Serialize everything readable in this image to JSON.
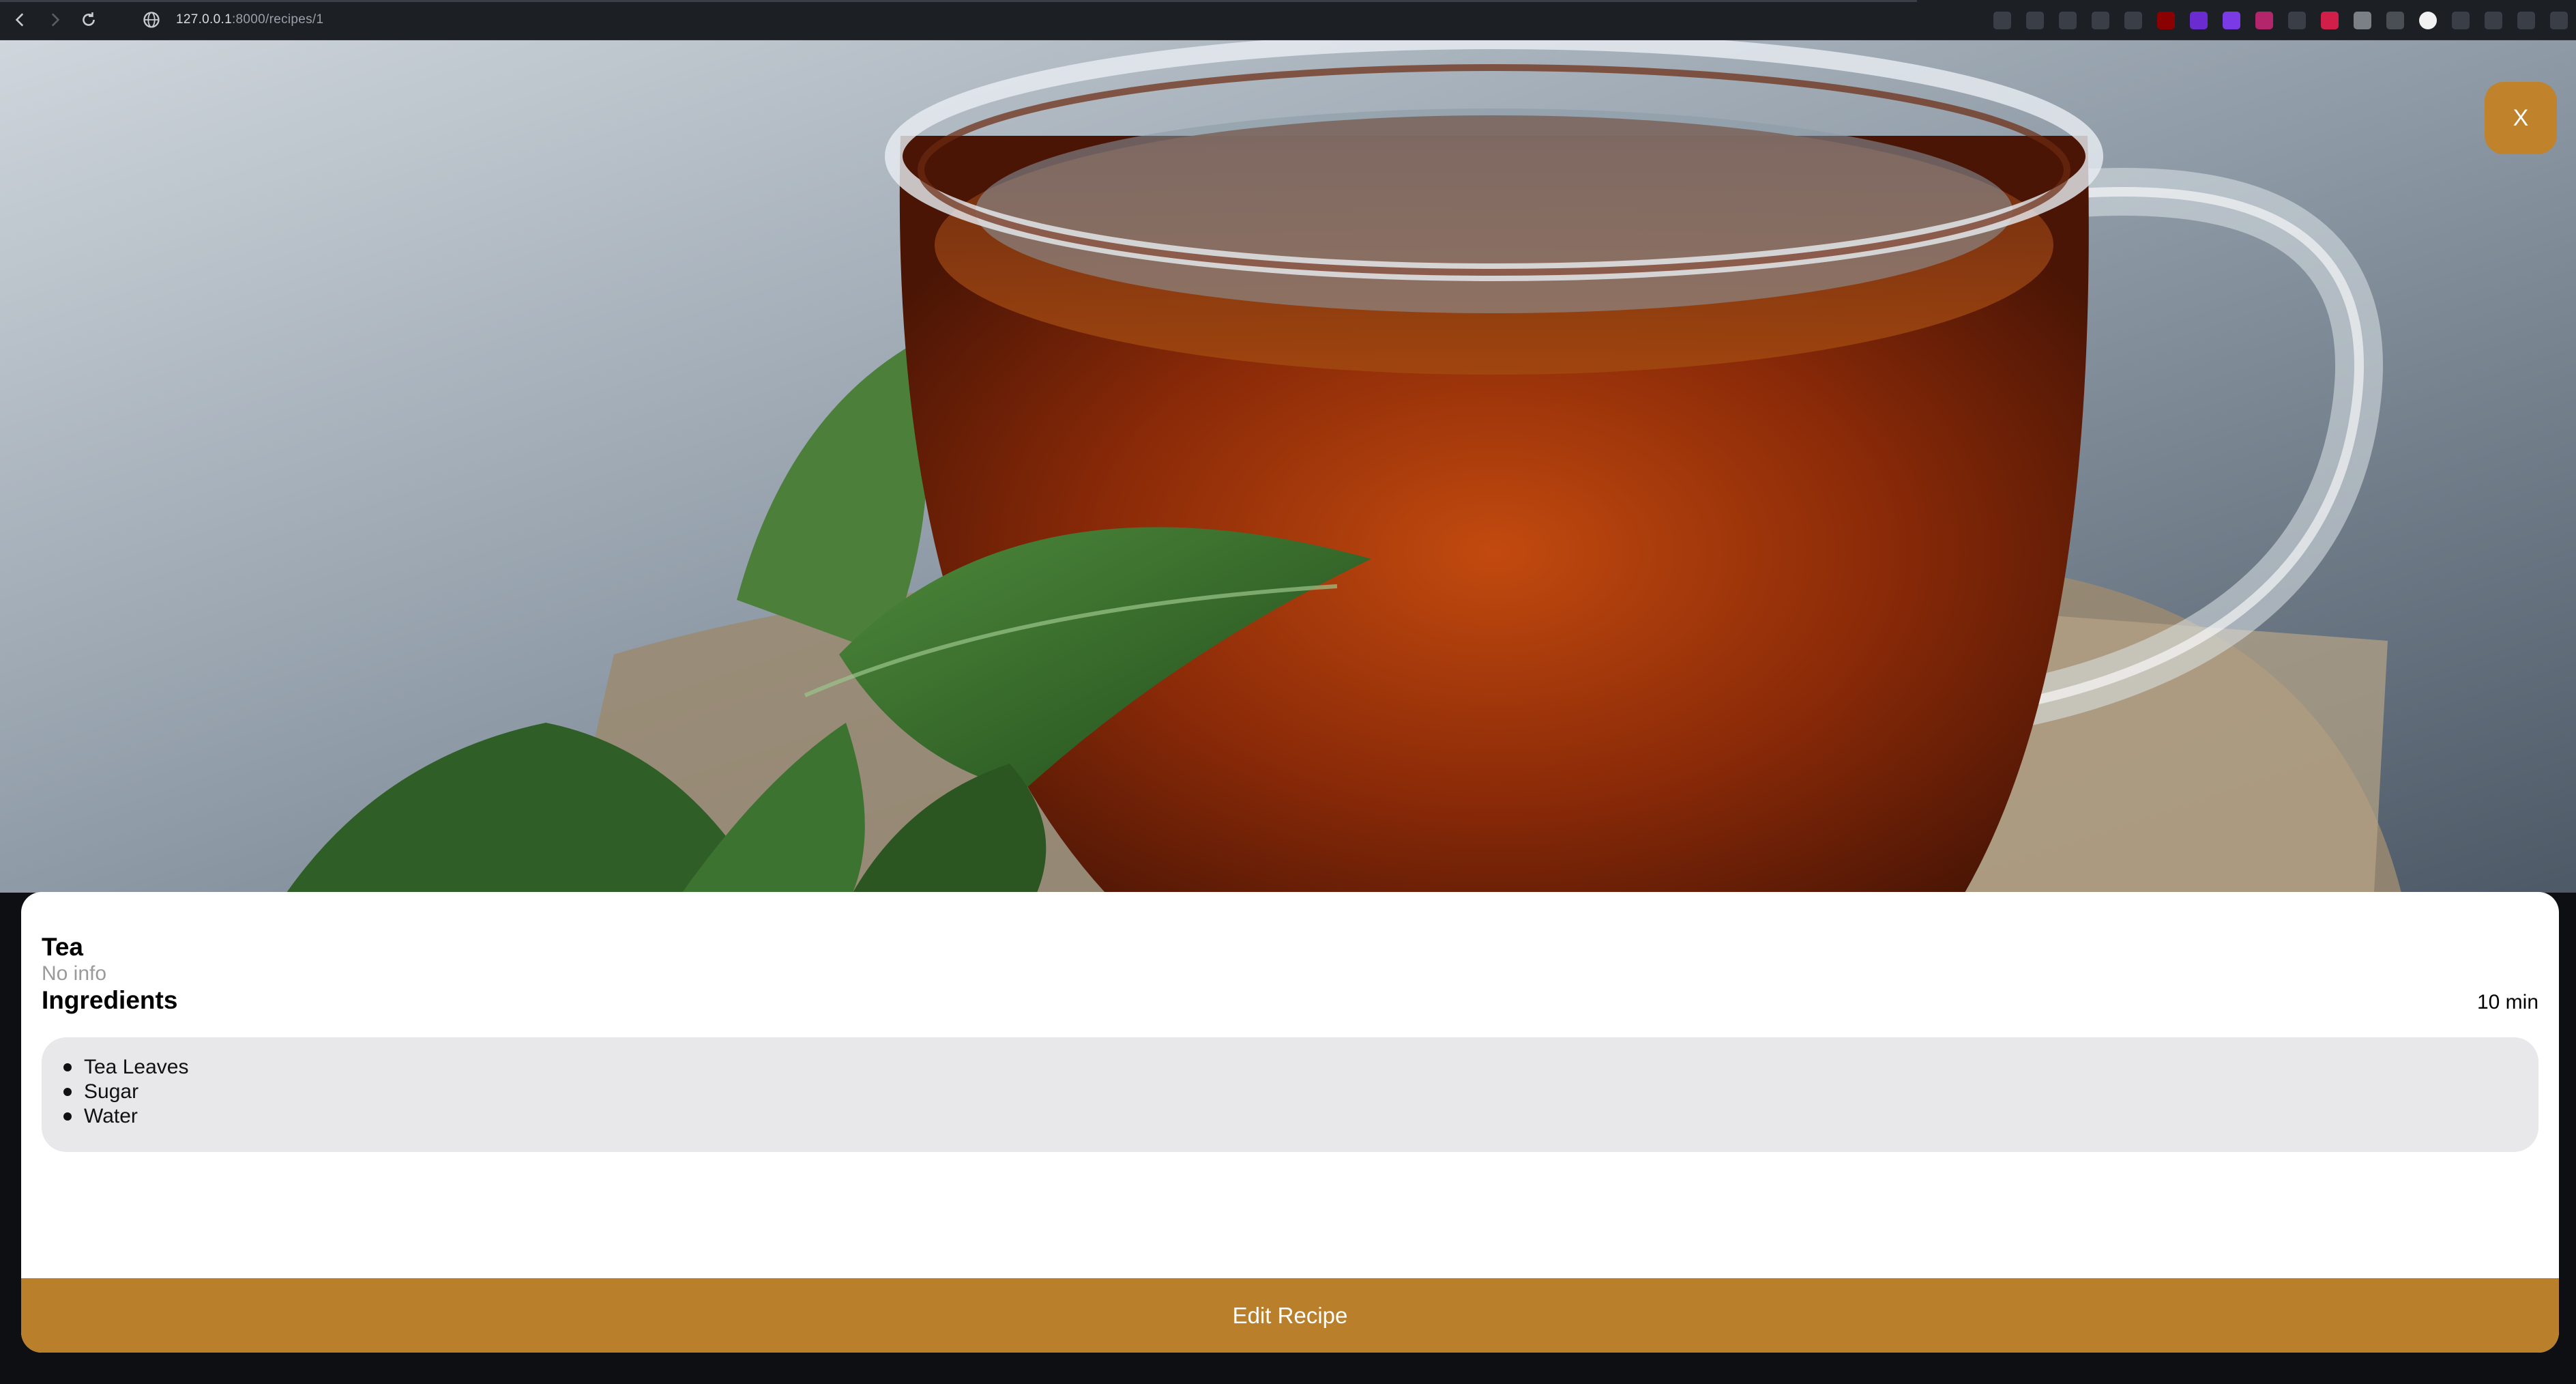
{
  "browser": {
    "url_host": "127.0.0.1",
    "url_path": ":8000/recipes/1",
    "extensions": [
      {
        "icon": "share-icon",
        "color": "#3a3f47"
      },
      {
        "icon": "camera-icon",
        "color": "#3a3f47"
      },
      {
        "icon": "shield-icon",
        "color": "#3a3f47"
      },
      {
        "icon": "send-icon",
        "color": "#3a3f47"
      },
      {
        "icon": "heart-icon",
        "color": "#3a3f47"
      },
      {
        "icon": "ublock-icon",
        "color": "#8b0000"
      },
      {
        "icon": "p-extension-icon",
        "color": "#6a2bd1"
      },
      {
        "icon": "grid-extension-icon",
        "color": "#7a3ae6"
      },
      {
        "icon": "sound-extension-icon",
        "color": "#b3266b"
      },
      {
        "icon": "react-icon",
        "color": "#3a3f47"
      },
      {
        "icon": "color-picker-icon",
        "color": "#d21f4a"
      },
      {
        "icon": "tile-extension-icon",
        "color": "#7b7f86"
      },
      {
        "icon": "page-extension-icon",
        "color": "#4a4f56"
      },
      {
        "icon": "s-extension-icon",
        "color": "#f2f2f2"
      },
      {
        "icon": "cube-icon",
        "color": "#3a3f47"
      },
      {
        "icon": "profile-icon",
        "color": "#3a3f47"
      },
      {
        "icon": "download-icon",
        "color": "#3a3f47"
      },
      {
        "icon": "menu-icon",
        "color": "#3a3f47"
      }
    ]
  },
  "close_button": {
    "label": "X"
  },
  "recipe": {
    "title": "Tea",
    "info": "No info",
    "ingredients_heading": "Ingredients",
    "duration": "10 min",
    "ingredients": [
      "Tea Leaves",
      "Sugar",
      "Water"
    ]
  },
  "edit_button": {
    "label": "Edit Recipe"
  },
  "colors": {
    "accent": "#c0822b",
    "card_bg": "#ffffff",
    "ingredient_box_bg": "#e8e8ea"
  }
}
